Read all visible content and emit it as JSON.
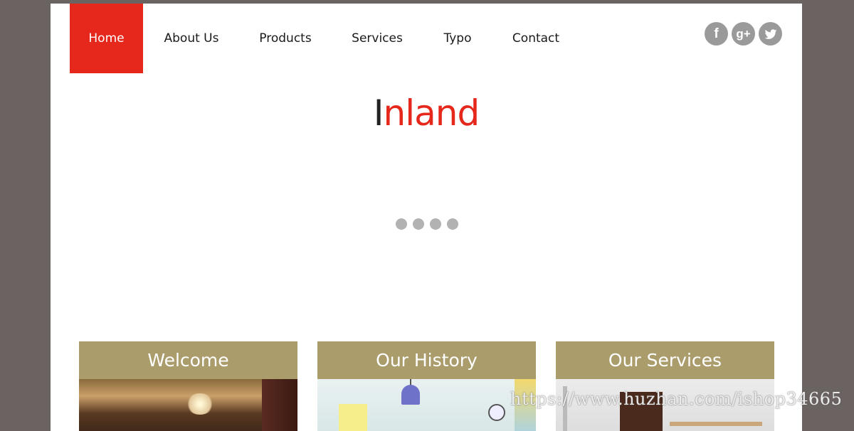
{
  "nav": {
    "items": [
      {
        "label": "Home",
        "active": true
      },
      {
        "label": "About Us"
      },
      {
        "label": "Products"
      },
      {
        "label": "Services"
      },
      {
        "label": "Typo"
      },
      {
        "label": "Contact"
      }
    ]
  },
  "social": {
    "facebook": "f",
    "googleplus": "g+",
    "twitter_icon": "twitter-icon"
  },
  "logo": {
    "first_letter": "I",
    "rest": "nland"
  },
  "slider": {
    "dot_count": 4
  },
  "cards": [
    {
      "title": "Welcome"
    },
    {
      "title": "Our History"
    },
    {
      "title": "Our Services"
    }
  ],
  "watermark": "https://www.huzhan.com/ishop34665",
  "colors": {
    "accent": "#e5281b",
    "card_header": "#ab9c6c",
    "background": "#6b6362",
    "social": "#9a9a9a"
  }
}
